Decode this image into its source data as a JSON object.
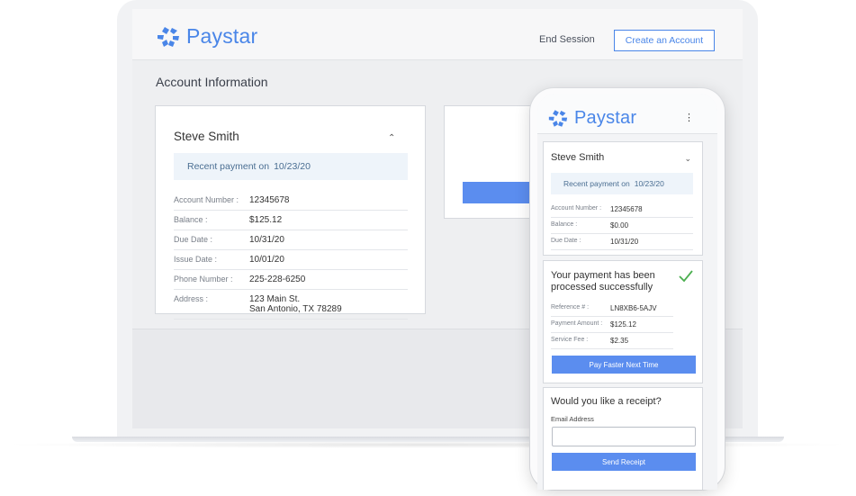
{
  "brand": {
    "name": "Paystar",
    "color": "#4a86e8",
    "logo_icon": "paystar-star-icon"
  },
  "header": {
    "end_session": "End Session",
    "create_account": "Create an Account"
  },
  "page": {
    "title": "Account Information"
  },
  "account_card": {
    "name": "Steve Smith",
    "recent_label": "Recent payment on",
    "recent_date": "10/23/20",
    "rows": [
      {
        "label": "Account Number :",
        "value": "12345678"
      },
      {
        "label": "Balance :",
        "value": "$125.12"
      },
      {
        "label": "Due Date :",
        "value": "10/31/20"
      },
      {
        "label": "Issue Date :",
        "value": "10/01/20"
      },
      {
        "label": "Phone Number :",
        "value": "225-228-6250"
      },
      {
        "label": "Address :",
        "value_line1": "123 Main St.",
        "value_line2": "San Antonio, TX 78289"
      }
    ]
  },
  "mobile": {
    "account": {
      "name": "Steve Smith",
      "recent_label": "Recent payment on",
      "recent_date": "10/23/20",
      "rows": [
        {
          "label": "Account Number :",
          "value": "12345678"
        },
        {
          "label": "Balance :",
          "value": "$0.00"
        },
        {
          "label": "Due Date :",
          "value": "10/31/20"
        }
      ]
    },
    "confirmation": {
      "message": "Your payment has been processed successfully",
      "rows": [
        {
          "label": "Reference # :",
          "value": "LN8XB6-5AJV"
        },
        {
          "label": "Payment Amount :",
          "value": "$125.12"
        },
        {
          "label": "Service Fee :",
          "value": "$2.35"
        }
      ],
      "button": "Pay Faster Next Time",
      "success_color": "#4caf50"
    },
    "receipt": {
      "question": "Would you like a receipt?",
      "email_label": "Email Address",
      "email_value": "",
      "button": "Send Receipt"
    }
  }
}
